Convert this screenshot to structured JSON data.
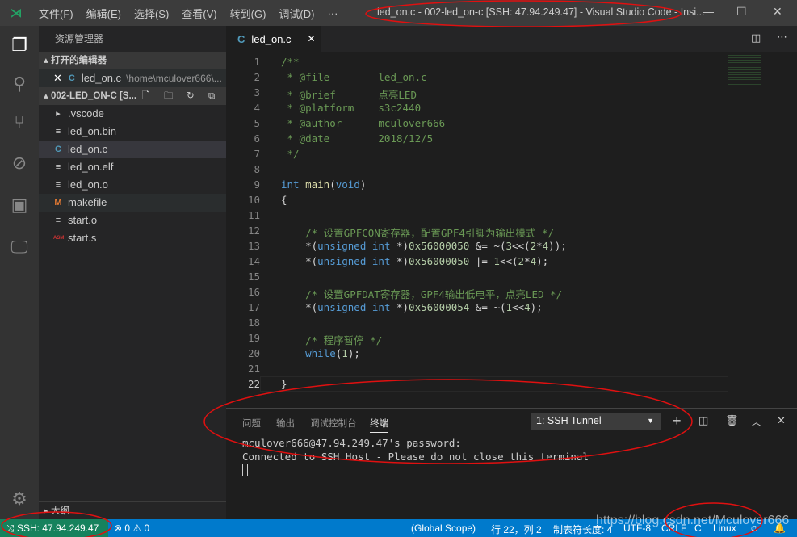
{
  "titlebar": {
    "menus": [
      "文件(F)",
      "编辑(E)",
      "选择(S)",
      "查看(V)",
      "转到(G)",
      "调试(D)",
      "···"
    ],
    "title": "led_on.c - 002-led_on-c [SSH: 47.94.249.47] - Visual Studio Code - Insi..."
  },
  "sidebar": {
    "title": "资源管理器",
    "open_editors": "打开的编辑器",
    "open_file": "led_on.c",
    "open_path": "\\home\\mculover666\\...",
    "project": "002-LED_ON-C [S...",
    "files": [
      {
        "name": ".vscode",
        "icon": "chevron-right"
      },
      {
        "name": "led_on.bin",
        "icon": "lines"
      },
      {
        "name": "led_on.c",
        "icon": "c"
      },
      {
        "name": "led_on.elf",
        "icon": "lines"
      },
      {
        "name": "led_on.o",
        "icon": "lines"
      },
      {
        "name": "makefile",
        "icon": "m"
      },
      {
        "name": "start.o",
        "icon": "lines"
      },
      {
        "name": "start.s",
        "icon": "asm"
      }
    ],
    "outline": "大纲"
  },
  "editor": {
    "tab": "led_on.c",
    "current_line": 22,
    "lines": [
      [
        [
          "/**",
          "c"
        ]
      ],
      [
        [
          " * @file        led_on.c",
          "c"
        ]
      ],
      [
        [
          " * @brief       点亮LED",
          "c"
        ]
      ],
      [
        [
          " * @platform    s3c2440",
          "c"
        ]
      ],
      [
        [
          " * @author      mculover666",
          "c"
        ]
      ],
      [
        [
          " * @date        2018/12/5",
          "c"
        ]
      ],
      [
        [
          " */",
          "c"
        ]
      ],
      [],
      [
        [
          "int",
          "k"
        ],
        [
          " ",
          ""
        ],
        [
          "main",
          "f"
        ],
        [
          "(",
          ""
        ],
        [
          "void",
          "k"
        ],
        [
          ")",
          ""
        ]
      ],
      [
        [
          "{",
          ""
        ]
      ],
      [],
      [
        [
          "    /* 设置GPFCON寄存器，配置GPF4引脚为输出模式 */",
          "c"
        ]
      ],
      [
        [
          "    *(",
          ""
        ],
        [
          "unsigned int",
          "k"
        ],
        [
          " *)",
          ""
        ],
        [
          "0x56000050",
          "n"
        ],
        [
          " &= ~(",
          ""
        ],
        [
          "3",
          "n"
        ],
        [
          "<<(",
          ""
        ],
        [
          "2",
          "n"
        ],
        [
          "*",
          ""
        ],
        [
          "4",
          "n"
        ],
        [
          "));",
          ""
        ]
      ],
      [
        [
          "    *(",
          ""
        ],
        [
          "unsigned int",
          "k"
        ],
        [
          " *)",
          ""
        ],
        [
          "0x56000050",
          "n"
        ],
        [
          " |= ",
          ""
        ],
        [
          "1",
          "n"
        ],
        [
          "<<(",
          ""
        ],
        [
          "2",
          "n"
        ],
        [
          "*",
          ""
        ],
        [
          "4",
          "n"
        ],
        [
          ");",
          ""
        ]
      ],
      [],
      [
        [
          "    /* 设置GPFDAT寄存器，GPF4输出低电平，点亮LED */",
          "c"
        ]
      ],
      [
        [
          "    *(",
          ""
        ],
        [
          "unsigned int",
          "k"
        ],
        [
          " *)",
          ""
        ],
        [
          "0x56000054",
          "n"
        ],
        [
          " &= ~(",
          ""
        ],
        [
          "1",
          "n"
        ],
        [
          "<<",
          ""
        ],
        [
          "4",
          "n"
        ],
        [
          ");",
          ""
        ]
      ],
      [],
      [
        [
          "    /* 程序暂停 */",
          "c"
        ]
      ],
      [
        [
          "    ",
          ""
        ],
        [
          "while",
          "k"
        ],
        [
          "(",
          ""
        ],
        [
          "1",
          "n"
        ],
        [
          ");",
          ""
        ]
      ],
      [],
      [
        [
          "}",
          ""
        ]
      ]
    ]
  },
  "panel": {
    "tabs": [
      "问题",
      "输出",
      "调试控制台",
      "终端"
    ],
    "active_tab": "终端",
    "terminal_select": "1: SSH Tunnel",
    "terminal_lines": [
      "mculover666@47.94.249.47's password:",
      "Connected to SSH Host - Please do not close this terminal"
    ]
  },
  "status": {
    "remote": "SSH: 47.94.249.47",
    "errors": "0",
    "warnings": "0",
    "scope": "(Global Scope)",
    "position": "行 22，列 2",
    "tab_size": "制表符长度: 4",
    "encoding": "UTF-8",
    "eol": "CRLF",
    "language": "C",
    "os": "Linux"
  },
  "watermark": "https://blog.csdn.net/Mculover666",
  "colors": {
    "status_bar": "#007acc",
    "remote": "#16825d",
    "annotation": "#e01010"
  }
}
